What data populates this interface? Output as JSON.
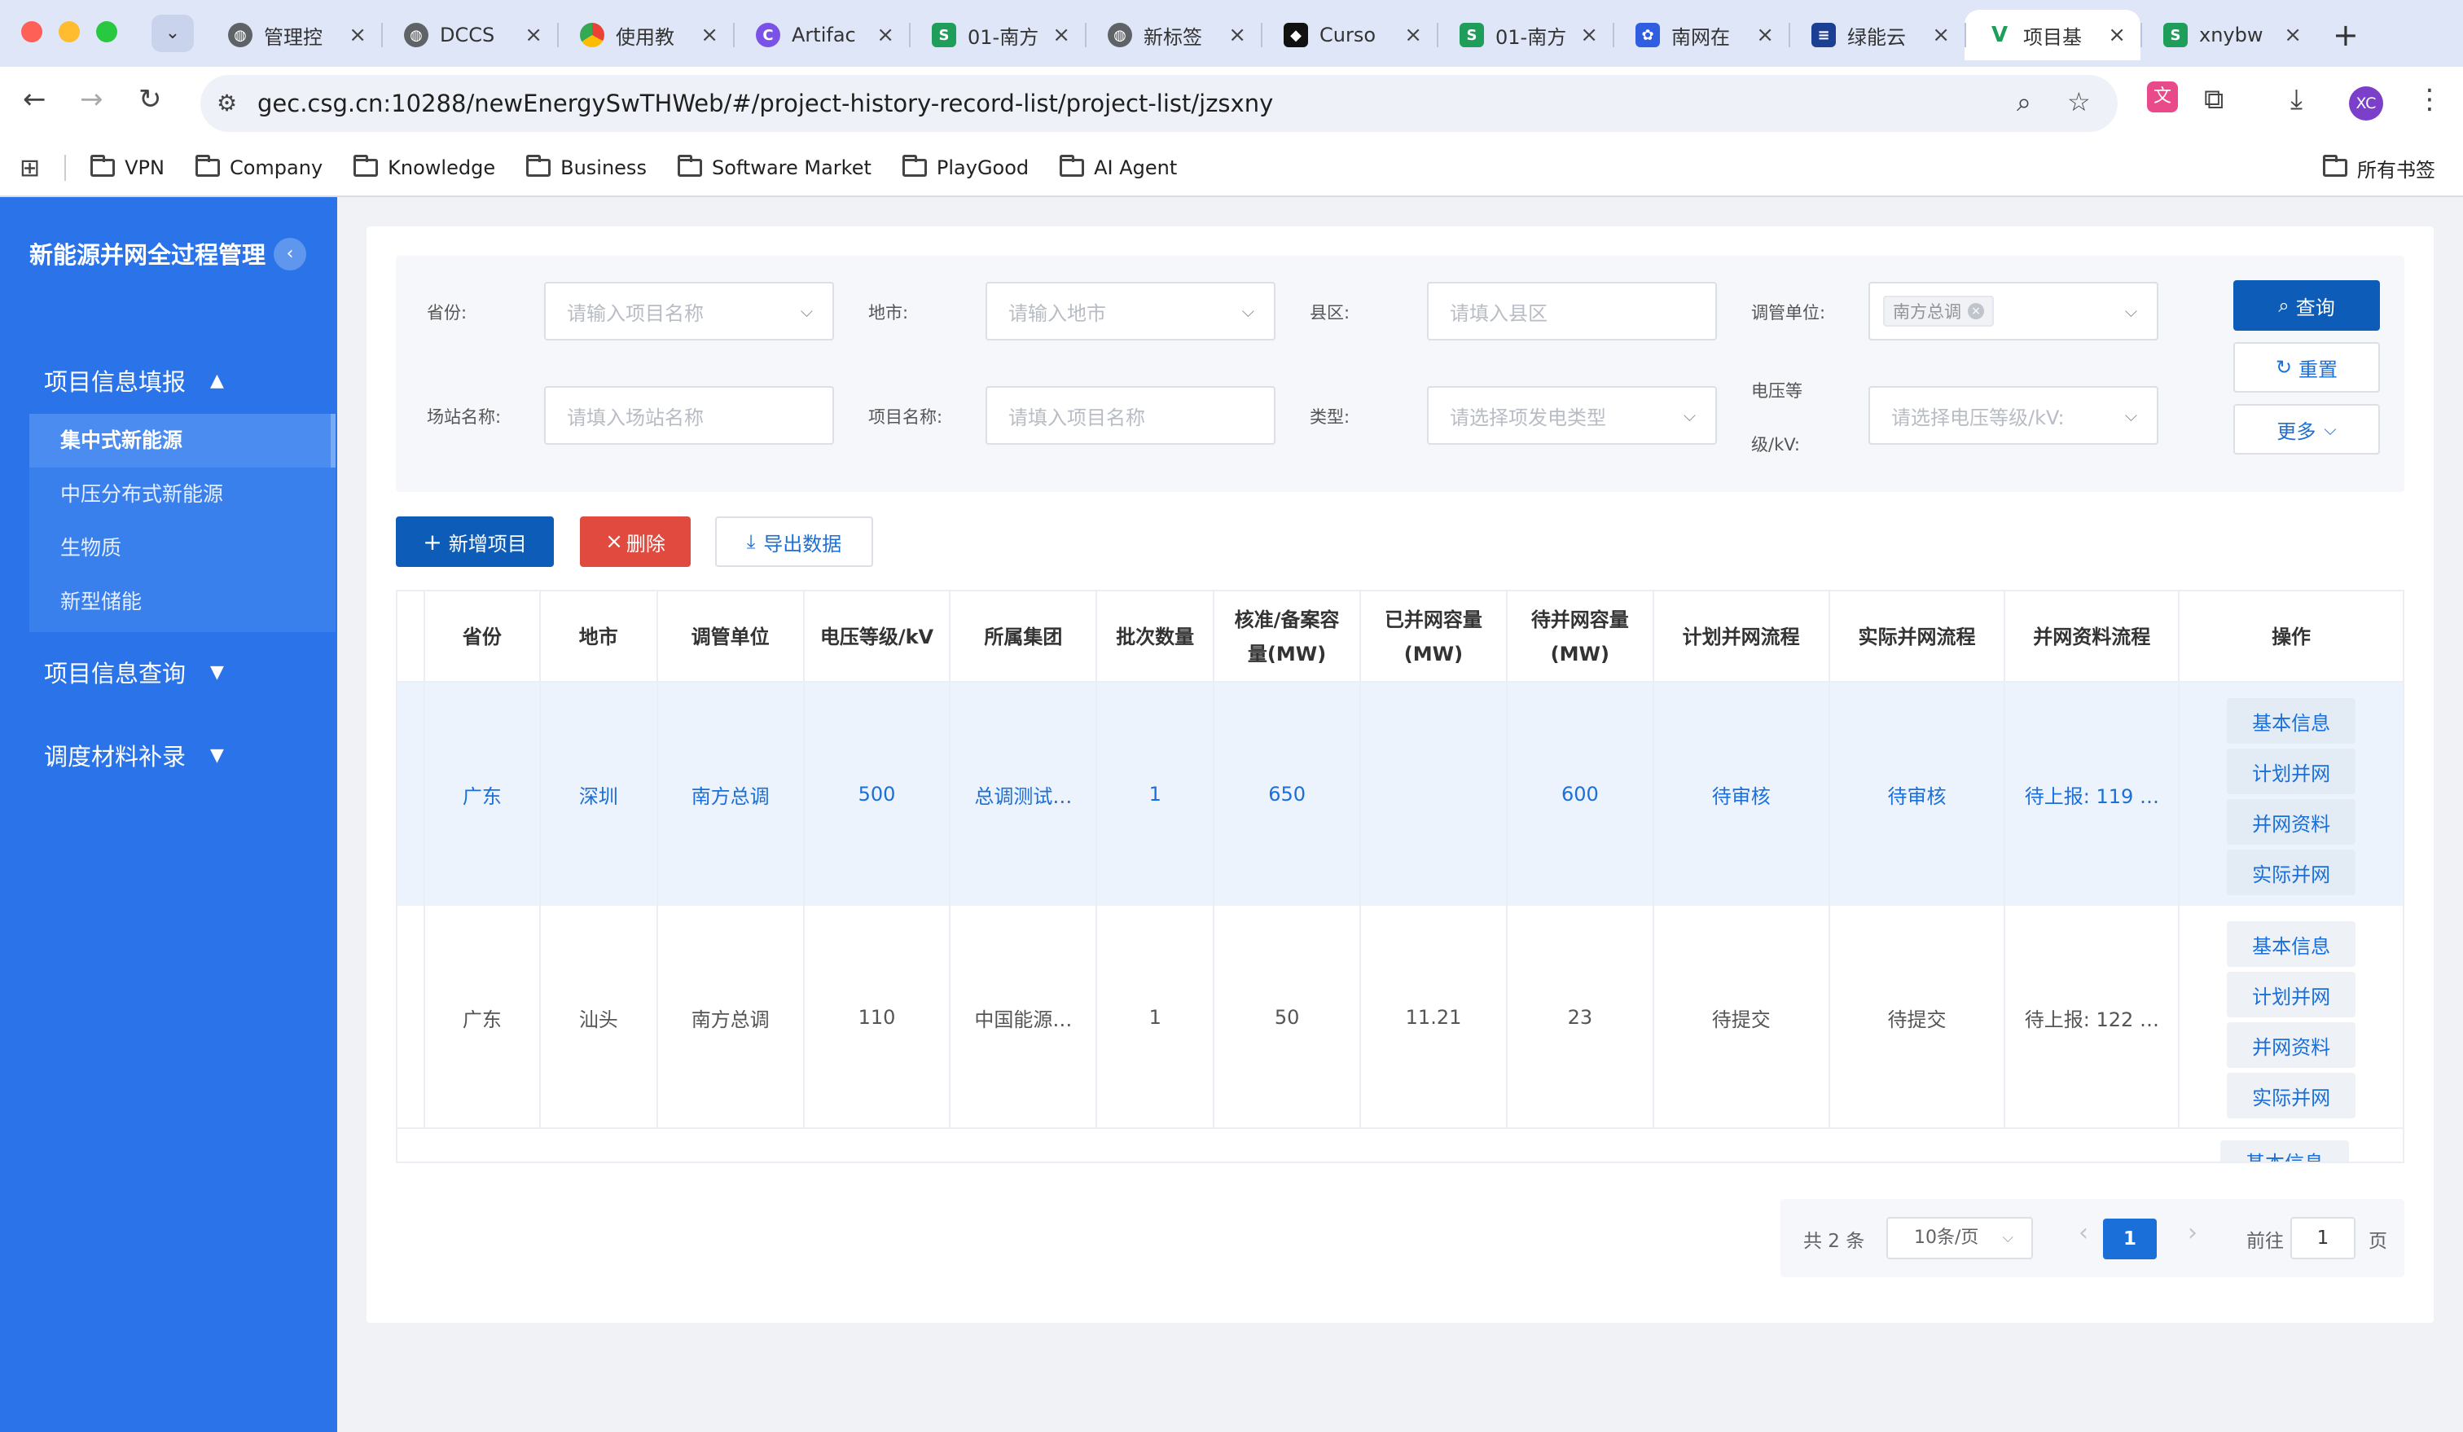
{
  "browser": {
    "tabs": [
      {
        "title": "管理控",
        "icon": "globe-icon",
        "active": false
      },
      {
        "title": "DCCS",
        "icon": "globe-icon",
        "active": false
      },
      {
        "title": "使用教",
        "icon": "chrome-icon",
        "active": false
      },
      {
        "title": "Artifac",
        "icon": "c-logo-icon",
        "active": false
      },
      {
        "title": "01-南方",
        "icon": "sheet-icon",
        "active": false
      },
      {
        "title": "新标签",
        "icon": "globe-icon",
        "active": false
      },
      {
        "title": "Curso",
        "icon": "cursor-icon",
        "active": false
      },
      {
        "title": "01-南方",
        "icon": "sheet-icon",
        "active": false
      },
      {
        "title": "南网在",
        "icon": "paw-icon",
        "active": false
      },
      {
        "title": "绿能云",
        "icon": "lines-icon",
        "active": false
      },
      {
        "title": "项目基",
        "icon": "v-logo-icon",
        "active": true
      },
      {
        "title": "xnybw",
        "icon": "sheet-icon",
        "active": false
      }
    ],
    "new_tab": "+",
    "url": "gec.csg.cn:10288/newEnergySwTHWeb/#/project-history-record-list/project-list/jzsxny",
    "bookmarks": [
      "VPN",
      "Company",
      "Knowledge",
      "Business",
      "Software Market",
      "PlayGood",
      "AI Agent"
    ],
    "all_bookmarks": "所有书签",
    "profile": "XC"
  },
  "sidebar": {
    "title": "新能源并网全过程管理",
    "collapse_icon": "‹",
    "groups": [
      {
        "label": "项目信息填报",
        "arrow": "▲"
      },
      {
        "label": "项目信息查询",
        "arrow": "▼"
      },
      {
        "label": "调度材料补录",
        "arrow": "▼"
      }
    ],
    "sub_items": [
      "集中式新能源",
      "中压分布式新能源",
      "生物质",
      "新型储能"
    ]
  },
  "filters": {
    "province": {
      "label": "省份:",
      "placeholder": "请输入项目名称"
    },
    "city": {
      "label": "地市:",
      "placeholder": "请输入地市"
    },
    "county": {
      "label": "县区:",
      "placeholder": "请填入县区"
    },
    "unit": {
      "label": "调管单位:",
      "chip": "南方总调"
    },
    "station": {
      "label": "场站名称:",
      "placeholder": "请填入场站名称"
    },
    "project": {
      "label": "项目名称:",
      "placeholder": "请填入项目名称"
    },
    "type": {
      "label": "类型:",
      "placeholder": "请选择项发电类型"
    },
    "voltage": {
      "label_1": "电压等",
      "label_2": "级/kV:",
      "placeholder": "请选择电压等级/kV:"
    }
  },
  "search_buttons": {
    "query": "查询",
    "reset": "重置",
    "more": "更多"
  },
  "actions": {
    "add": "新增项目",
    "delete": "删除",
    "export": "导出数据"
  },
  "table": {
    "headers": [
      "省份",
      "地市",
      "调管单位",
      "电压等级/kV",
      "所属集团",
      "批次数量",
      "核准/备案容量(MW)",
      "已并网容量(MW)",
      "待并网容量(MW)",
      "计划并网流程",
      "实际并网流程",
      "并网资料流程",
      "操作"
    ],
    "rows": [
      [
        "广东",
        "深圳",
        "南方总调",
        "500",
        "总调测试…",
        "1",
        "650",
        "",
        "600",
        "待审核",
        "待审核",
        "待上报: 119 …"
      ],
      [
        "广东",
        "汕头",
        "南方总调",
        "110",
        "中国能源…",
        "1",
        "50",
        "11.21",
        "23",
        "待提交",
        "待提交",
        "待上报: 122 …"
      ]
    ],
    "row_ops": [
      "基本信息",
      "计划并网",
      "并网资料",
      "实际并网"
    ],
    "partial_op": "基本信息"
  },
  "pagination": {
    "total": "共 2 条",
    "page_size": "10条/页",
    "current": "1",
    "goto_label": "前往",
    "goto_value": "1",
    "page_unit": "页",
    "prev": "‹",
    "next": "›"
  },
  "colors": {
    "sidebar": "#2a73e8",
    "primary": "#0d5db8",
    "danger": "#e04a3f",
    "link": "#1a6fd8"
  }
}
